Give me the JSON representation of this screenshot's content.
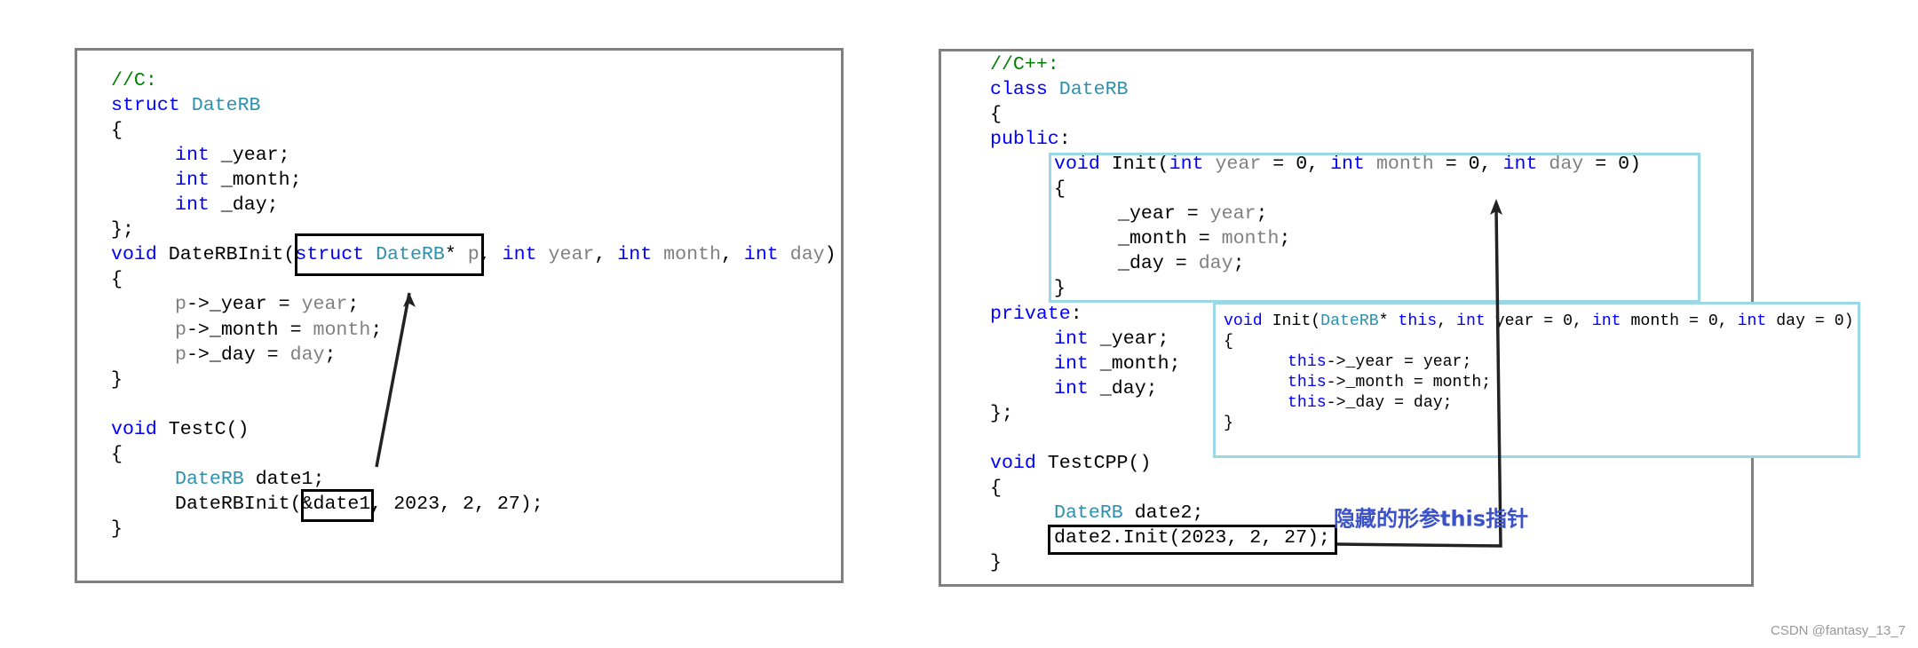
{
  "colors": {
    "keyword": "#0000ff",
    "type": "#2b91af",
    "param": "#808080",
    "comment": "#008000",
    "highlight_black": "#000000",
    "highlight_cyan": "#9ad8e6",
    "annotation": "#3c52c8"
  },
  "left_panel": {
    "lines": [
      [
        [
          "//C:",
          "cm"
        ]
      ],
      [
        [
          "struct",
          "kw"
        ],
        [
          " ",
          "pl"
        ],
        [
          "DateRB",
          "ty"
        ]
      ],
      [
        [
          "{",
          "pl"
        ]
      ],
      [
        [
          "\t",
          "pl"
        ],
        [
          "int",
          "kw"
        ],
        [
          " _year;",
          "pl"
        ]
      ],
      [
        [
          "\t",
          "pl"
        ],
        [
          "int",
          "kw"
        ],
        [
          " _month;",
          "pl"
        ]
      ],
      [
        [
          "\t",
          "pl"
        ],
        [
          "int",
          "kw"
        ],
        [
          " _day;",
          "pl"
        ]
      ],
      [
        [
          "};",
          "pl"
        ]
      ],
      [
        [
          "void",
          "kw"
        ],
        [
          " DateRBInit(",
          "pl"
        ],
        [
          "struct",
          "kw"
        ],
        [
          " ",
          "pl"
        ],
        [
          "DateRB",
          "ty"
        ],
        [
          "* ",
          "pl"
        ],
        [
          "p",
          "pa"
        ],
        [
          ", ",
          "pl"
        ],
        [
          "int",
          "kw"
        ],
        [
          " ",
          "pl"
        ],
        [
          "year",
          "pa"
        ],
        [
          ", ",
          "pl"
        ],
        [
          "int",
          "kw"
        ],
        [
          " ",
          "pl"
        ],
        [
          "month",
          "pa"
        ],
        [
          ", ",
          "pl"
        ],
        [
          "int",
          "kw"
        ],
        [
          " ",
          "pl"
        ],
        [
          "day",
          "pa"
        ],
        [
          ")",
          "pl"
        ]
      ],
      [
        [
          "{",
          "pl"
        ]
      ],
      [
        [
          "\t",
          "pl"
        ],
        [
          "p",
          "pa"
        ],
        [
          "->_year = ",
          "pl"
        ],
        [
          "year",
          "pa"
        ],
        [
          ";",
          "pl"
        ]
      ],
      [
        [
          "\t",
          "pl"
        ],
        [
          "p",
          "pa"
        ],
        [
          "->_month = ",
          "pl"
        ],
        [
          "month",
          "pa"
        ],
        [
          ";",
          "pl"
        ]
      ],
      [
        [
          "\t",
          "pl"
        ],
        [
          "p",
          "pa"
        ],
        [
          "->_day = ",
          "pl"
        ],
        [
          "day",
          "pa"
        ],
        [
          ";",
          "pl"
        ]
      ],
      [
        [
          "}",
          "pl"
        ]
      ],
      [],
      [
        [
          "void",
          "kw"
        ],
        [
          " TestC()",
          "pl"
        ]
      ],
      [
        [
          "{",
          "pl"
        ]
      ],
      [
        [
          "\t",
          "pl"
        ],
        [
          "DateRB",
          "ty"
        ],
        [
          " date1;",
          "pl"
        ]
      ],
      [
        [
          "\tDateRBInit(&date1, 2023, 2, 27);",
          "pl"
        ]
      ],
      [
        [
          "}",
          "pl"
        ]
      ]
    ]
  },
  "right_panel": {
    "lines": [
      [
        [
          "//C++:",
          "cm"
        ]
      ],
      [
        [
          "class",
          "kw"
        ],
        [
          " ",
          "pl"
        ],
        [
          "DateRB",
          "ty"
        ]
      ],
      [
        [
          "{",
          "pl"
        ]
      ],
      [
        [
          "public",
          "kw"
        ],
        [
          ":",
          "pl"
        ]
      ],
      [
        [
          "\t",
          "pl"
        ],
        [
          "void",
          "kw"
        ],
        [
          " Init(",
          "pl"
        ],
        [
          "int",
          "kw"
        ],
        [
          " ",
          "pl"
        ],
        [
          "year",
          "pa"
        ],
        [
          " = 0, ",
          "pl"
        ],
        [
          "int",
          "kw"
        ],
        [
          " ",
          "pl"
        ],
        [
          "month",
          "pa"
        ],
        [
          " = 0, ",
          "pl"
        ],
        [
          "int",
          "kw"
        ],
        [
          " ",
          "pl"
        ],
        [
          "day",
          "pa"
        ],
        [
          " = 0)",
          "pl"
        ]
      ],
      [
        [
          "\t{",
          "pl"
        ]
      ],
      [
        [
          "\t\t_year = ",
          "pl"
        ],
        [
          "year",
          "pa"
        ],
        [
          ";",
          "pl"
        ]
      ],
      [
        [
          "\t\t_month = ",
          "pl"
        ],
        [
          "month",
          "pa"
        ],
        [
          ";",
          "pl"
        ]
      ],
      [
        [
          "\t\t_day = ",
          "pl"
        ],
        [
          "day",
          "pa"
        ],
        [
          ";",
          "pl"
        ]
      ],
      [
        [
          "\t}",
          "pl"
        ]
      ],
      [
        [
          "private",
          "kw"
        ],
        [
          ":",
          "pl"
        ]
      ],
      [
        [
          "\t",
          "pl"
        ],
        [
          "int",
          "kw"
        ],
        [
          " _year;",
          "pl"
        ]
      ],
      [
        [
          "\t",
          "pl"
        ],
        [
          "int",
          "kw"
        ],
        [
          " _month;",
          "pl"
        ]
      ],
      [
        [
          "\t",
          "pl"
        ],
        [
          "int",
          "kw"
        ],
        [
          " _day;",
          "pl"
        ]
      ],
      [
        [
          "};",
          "pl"
        ]
      ],
      [],
      [
        [
          "void",
          "kw"
        ],
        [
          " TestCPP()",
          "pl"
        ]
      ],
      [
        [
          "{",
          "pl"
        ]
      ],
      [
        [
          "\t",
          "pl"
        ],
        [
          "DateRB",
          "ty"
        ],
        [
          " date2;",
          "pl"
        ]
      ],
      [
        [
          "\tdate2.Init(2023, 2, 27);",
          "pl"
        ]
      ],
      [
        [
          "}",
          "pl"
        ]
      ]
    ]
  },
  "hidden_this_box": {
    "lines": [
      [
        [
          "void",
          "kw"
        ],
        [
          " Init(",
          "pl"
        ],
        [
          "DateRB",
          "ty"
        ],
        [
          "* ",
          "pl"
        ],
        [
          "this",
          "kw"
        ],
        [
          ", ",
          "pl"
        ],
        [
          "int",
          "kw"
        ],
        [
          " year = 0, ",
          "pl"
        ],
        [
          "int",
          "kw"
        ],
        [
          " month = 0, ",
          "pl"
        ],
        [
          "int",
          "kw"
        ],
        [
          " day = 0)",
          "pl"
        ]
      ],
      [
        [
          "{",
          "pl"
        ]
      ],
      [
        [
          "\t",
          "pl"
        ],
        [
          "this",
          "kw"
        ],
        [
          "->_year = year;",
          "pl"
        ]
      ],
      [
        [
          "\t",
          "pl"
        ],
        [
          "this",
          "kw"
        ],
        [
          "->_month = month;",
          "pl"
        ]
      ],
      [
        [
          "\t",
          "pl"
        ],
        [
          "this",
          "kw"
        ],
        [
          "->_day = day;",
          "pl"
        ]
      ],
      [
        [
          "}",
          "pl"
        ]
      ]
    ]
  },
  "annotation": {
    "label": "隐藏的形参this指针"
  },
  "watermark": "CSDN @fantasy_13_7"
}
